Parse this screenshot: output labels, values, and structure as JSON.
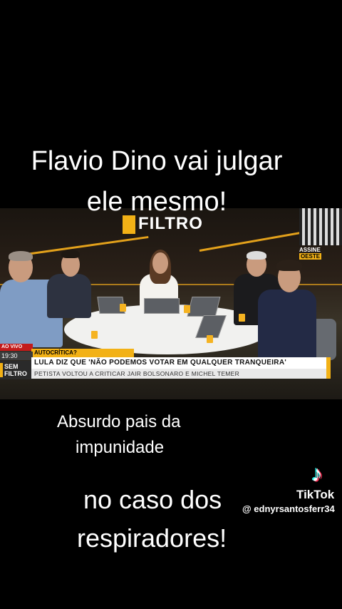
{
  "captions": {
    "top_line1": "Flavio Dino vai julgar",
    "top_line2": "ele mesmo!",
    "mid_line1": "Absurdo pais da",
    "mid_line2": "impunidade",
    "bottom_line1": "no caso dos",
    "bottom_line2": "respiradores!"
  },
  "broadcast": {
    "logo_text": "FILTRO",
    "assine_label": "ASSINE",
    "assine_tag": "OESTE",
    "live_label": "AO VIVO",
    "clock": "19:30",
    "topic": "AUTOCRÍTICA?",
    "brand_line1": "SEM",
    "brand_line2": "FILTRO",
    "headline": "LULA DIZ QUE 'NÃO PODEMOS VOTAR EM QUALQUER TRANQUEIRA'",
    "subheadline": "PETISTA VOLTOU A CRITICAR JAIR BOLSONARO E MICHEL TEMER"
  },
  "tiktok": {
    "icon": "tiktok-note-icon",
    "wordmark": "TikTok",
    "username": "@ ednyrsantosferr34"
  },
  "colors": {
    "accent": "#f2b116",
    "live_red": "#c31b1b",
    "background": "#000000"
  }
}
